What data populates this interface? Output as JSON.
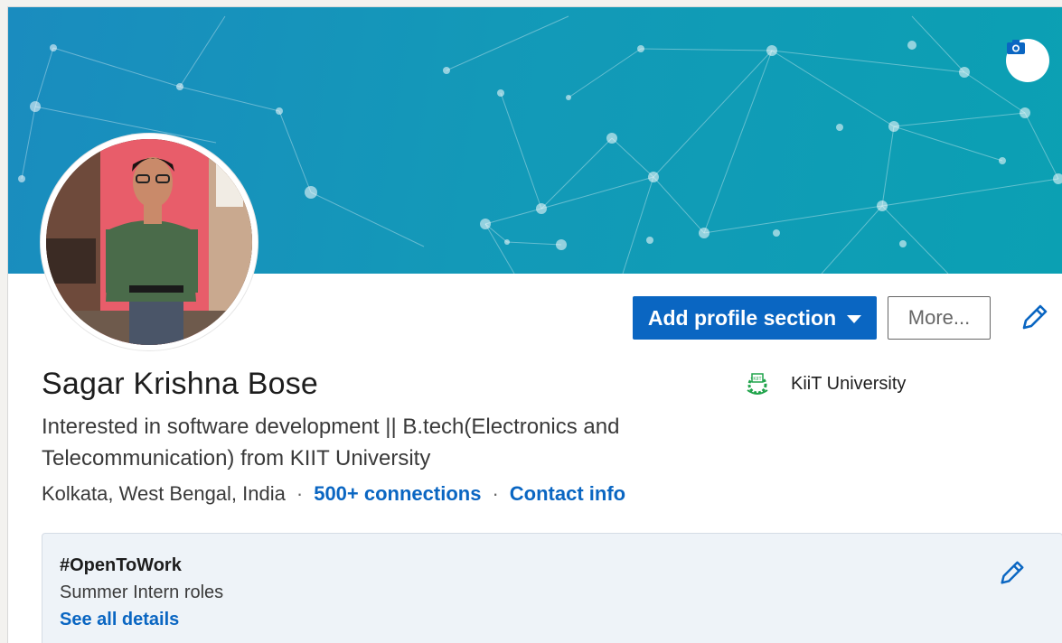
{
  "profile": {
    "name": "Sagar Krishna Bose",
    "headline_line1": "Interested in software development || B.tech(Electronics and",
    "headline_line2": "Telecommunication) from KIIT University",
    "location": "Kolkata, West Bengal, India",
    "separator": "·",
    "connections": "500+ connections",
    "contact_info": "Contact info"
  },
  "education": {
    "school": "KiiT University",
    "logo_icon": "school-logo-icon"
  },
  "actions": {
    "add_section_label": "Add profile section",
    "more_label": "More...",
    "edit_icon": "pencil-icon",
    "camera_icon": "camera-icon"
  },
  "open_to_work": {
    "title": "#OpenToWork",
    "roles": "Summer Intern roles",
    "see_details": "See all details"
  },
  "colors": {
    "accent": "#0a66c2",
    "banner": "#1399b8",
    "open_to_work_bg": "#eef3f8"
  }
}
